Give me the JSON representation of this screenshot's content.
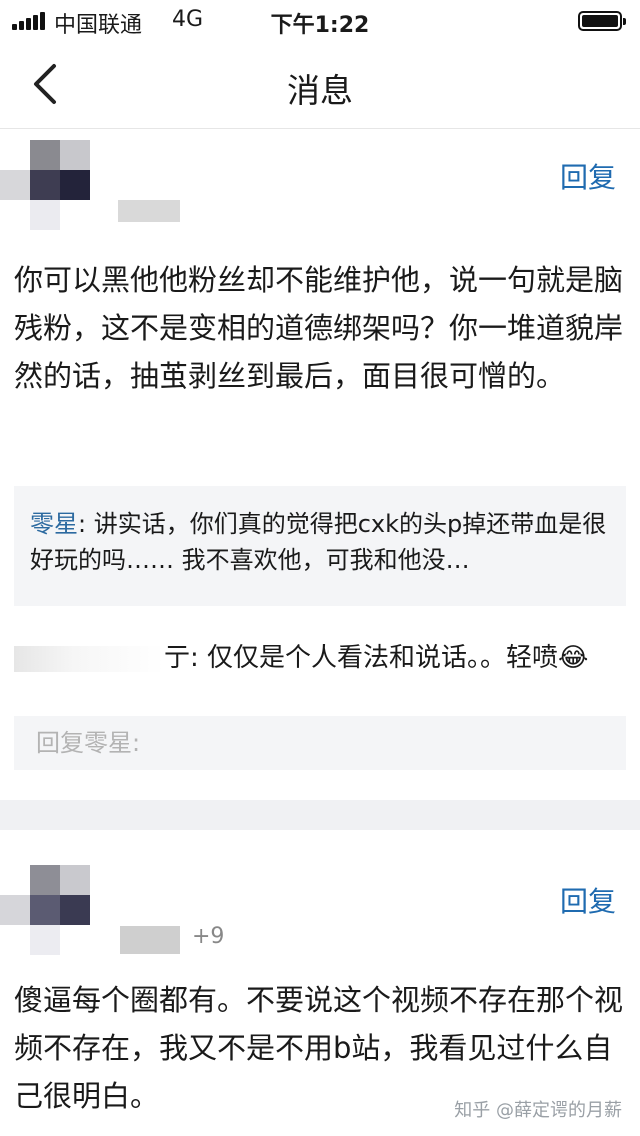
{
  "status_bar": {
    "carrier": "中国联通",
    "network": "4G",
    "time": "下午1:22"
  },
  "nav": {
    "title": "消息",
    "back_icon": "chevron-left-icon"
  },
  "comment1": {
    "reply_label": "回复",
    "content": "你可以黑他他粉丝却不能维护他，说一句就是脑残粉，这不是变相的道德绑架吗？你一堆道貌岸然的话，抽茧剥丝到最后，面目很可憎的。",
    "quote_author": "零星",
    "quote_text": ": 讲实话，你们真的觉得把cxk的头p掉还带血是很好玩的吗…… 我不喜欢他，可我和他没…",
    "sub_reply_tail": "亍: 仅仅是个人看法和说话。。轻喷😂",
    "reply_placeholder": "回复零星:"
  },
  "comment2": {
    "reply_label": "回复",
    "meta_tail": "+9",
    "content": "傻逼每个圈都有。不要说这个视频不存在那个视频不存在，我又不是不用b站，我看见过什么自己很明白。"
  },
  "watermark": "知乎 @薛定谔的月薪",
  "colors": {
    "link": "#1f6bb0",
    "quote_bg": "#f4f5f7",
    "divider": "#f0f1f3"
  }
}
